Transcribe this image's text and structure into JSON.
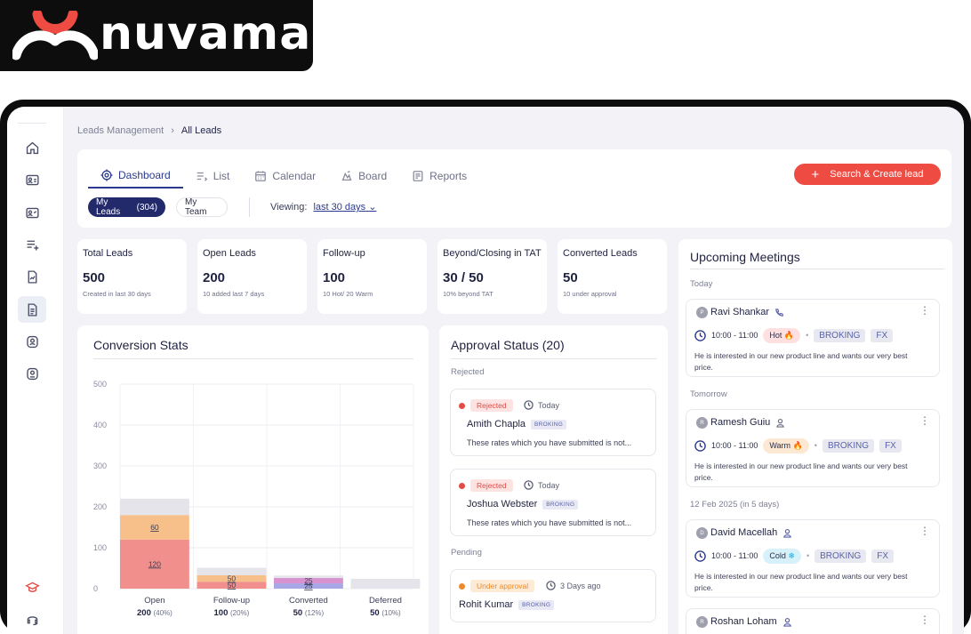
{
  "brand": {
    "name": "nuvama",
    "colors": {
      "accent": "#ee4b42",
      "primary": "#232a6b",
      "dark": "#0d0d0d"
    }
  },
  "sidebar": {
    "icons": [
      "home-icon",
      "contact-card-icon",
      "id-card-icon",
      "playlist-add-icon",
      "document-chart-icon",
      "document-list-icon",
      "profile-badge-icon",
      "profile-badge-alt-icon",
      "graduation-icon",
      "headset-icon"
    ]
  },
  "breadcrumb": {
    "parent": "Leads Management",
    "separator": "›",
    "current": "All Leads"
  },
  "tabs": [
    {
      "label": "Dashboard",
      "icon": "target-icon",
      "active": true
    },
    {
      "label": "List",
      "icon": "list-icon"
    },
    {
      "label": "Calendar",
      "icon": "calendar-icon"
    },
    {
      "label": "Board",
      "icon": "board-icon"
    },
    {
      "label": "Reports",
      "icon": "reports-icon"
    }
  ],
  "create_button": {
    "label": "Search & Create lead"
  },
  "filters": {
    "my_leads": "My Leads",
    "my_leads_count": "(304)",
    "my_team": "My Team",
    "viewing_label": "Viewing:",
    "viewing_value": "last 30 days"
  },
  "stats": [
    {
      "title": "Total Leads",
      "value": "500",
      "sub": "Created in last 30 days"
    },
    {
      "title": "Open Leads",
      "value": "200",
      "sub": "10 added last 7 days"
    },
    {
      "title": "Follow-up",
      "value": "100",
      "sub": "10 Hot/ 20 Warm"
    },
    {
      "title": "Beyond/Closing in TAT",
      "value": "30 / 50",
      "sub": "10% beyond TAT"
    },
    {
      "title": "Converted Leads",
      "value": "50",
      "sub": "10 under approval"
    }
  ],
  "conversion": {
    "title": "Conversion Stats",
    "chart_data": {
      "type": "bar",
      "stacked": true,
      "ylim": [
        0,
        500
      ],
      "yticks": [
        500,
        400,
        300,
        200,
        100,
        0
      ],
      "categories": [
        "Open",
        "Follow-up",
        "Converted",
        "Deferred"
      ],
      "totals": [
        "200",
        "100",
        "50",
        "50"
      ],
      "percents": [
        "(40%)",
        "(20%)",
        "(12%)",
        "(10%)"
      ],
      "bars": [
        {
          "segments": [
            {
              "value": 120,
              "color": "#f08f8c",
              "label": "120"
            },
            {
              "value": 60,
              "color": "#f7c08a",
              "label": "60"
            },
            {
              "value": 40,
              "color": "#e4e4ea",
              "label": ""
            }
          ]
        },
        {
          "segments": [
            {
              "value": 17,
              "color": "#f08f8c",
              "label": "50"
            },
            {
              "value": 16,
              "color": "#f7c08a",
              "label": "50"
            },
            {
              "value": 18,
              "color": "#e4e4ea",
              "label": ""
            }
          ]
        },
        {
          "segments": [
            {
              "value": 13,
              "color": "#a8a7e6",
              "label": "25"
            },
            {
              "value": 13,
              "color": "#d992d0",
              "label": "25"
            },
            {
              "value": 6,
              "color": "#e4e4ea",
              "label": ""
            }
          ]
        },
        {
          "segments": [
            {
              "value": 24,
              "color": "#e4e4ea",
              "label": ""
            }
          ]
        }
      ]
    }
  },
  "approval": {
    "title": "Approval Status (20)",
    "groups": [
      {
        "label": "Rejected"
      },
      {
        "label": "Pending"
      }
    ],
    "items": [
      {
        "status": "Rejected",
        "time": "Today",
        "name": "Amith Chapla",
        "tag": "BROKING",
        "desc": "These rates which you have submitted is not..."
      },
      {
        "status": "Rejected",
        "time": "Today",
        "name": "Joshua Webster",
        "tag": "BROKING",
        "desc": "These rates which you have submitted is not..."
      },
      {
        "status": "Under approval",
        "time": "3 Days ago",
        "name": "Rohit Kumar",
        "tag": "BROKING"
      }
    ]
  },
  "meetings": {
    "title": "Upcoming Meetings",
    "groups": [
      "Today",
      "Tomorrow",
      "12 Feb 2025 (in 5 days)"
    ],
    "items": [
      {
        "initial": "P",
        "name": "Ravi Shankar",
        "icon": "phone-icon",
        "time": "10:00 - 11:00",
        "temp": "Hot",
        "temp_icon": "🔥",
        "tags": [
          "BROKING",
          "FX"
        ],
        "note": "He is interested in our new product line and wants our very best price."
      },
      {
        "initial": "R",
        "name": "Ramesh Guiu",
        "icon": "person-icon",
        "time": "10:00 - 11:00",
        "temp": "Warm",
        "temp_icon": "🔥",
        "tags": [
          "BROKING",
          "FX"
        ],
        "note": "He is interested in our new product line and wants our very best price."
      },
      {
        "initial": "D",
        "name": "David Macellah",
        "icon": "person-icon",
        "time": "10:00 - 11:00",
        "temp": "Cold",
        "temp_icon": "❄",
        "tags": [
          "BROKING",
          "FX"
        ],
        "note": "He is interested in our new product line and wants our very best price."
      },
      {
        "initial": "R",
        "name": "Roshan Loham",
        "icon": "person-icon"
      }
    ]
  }
}
